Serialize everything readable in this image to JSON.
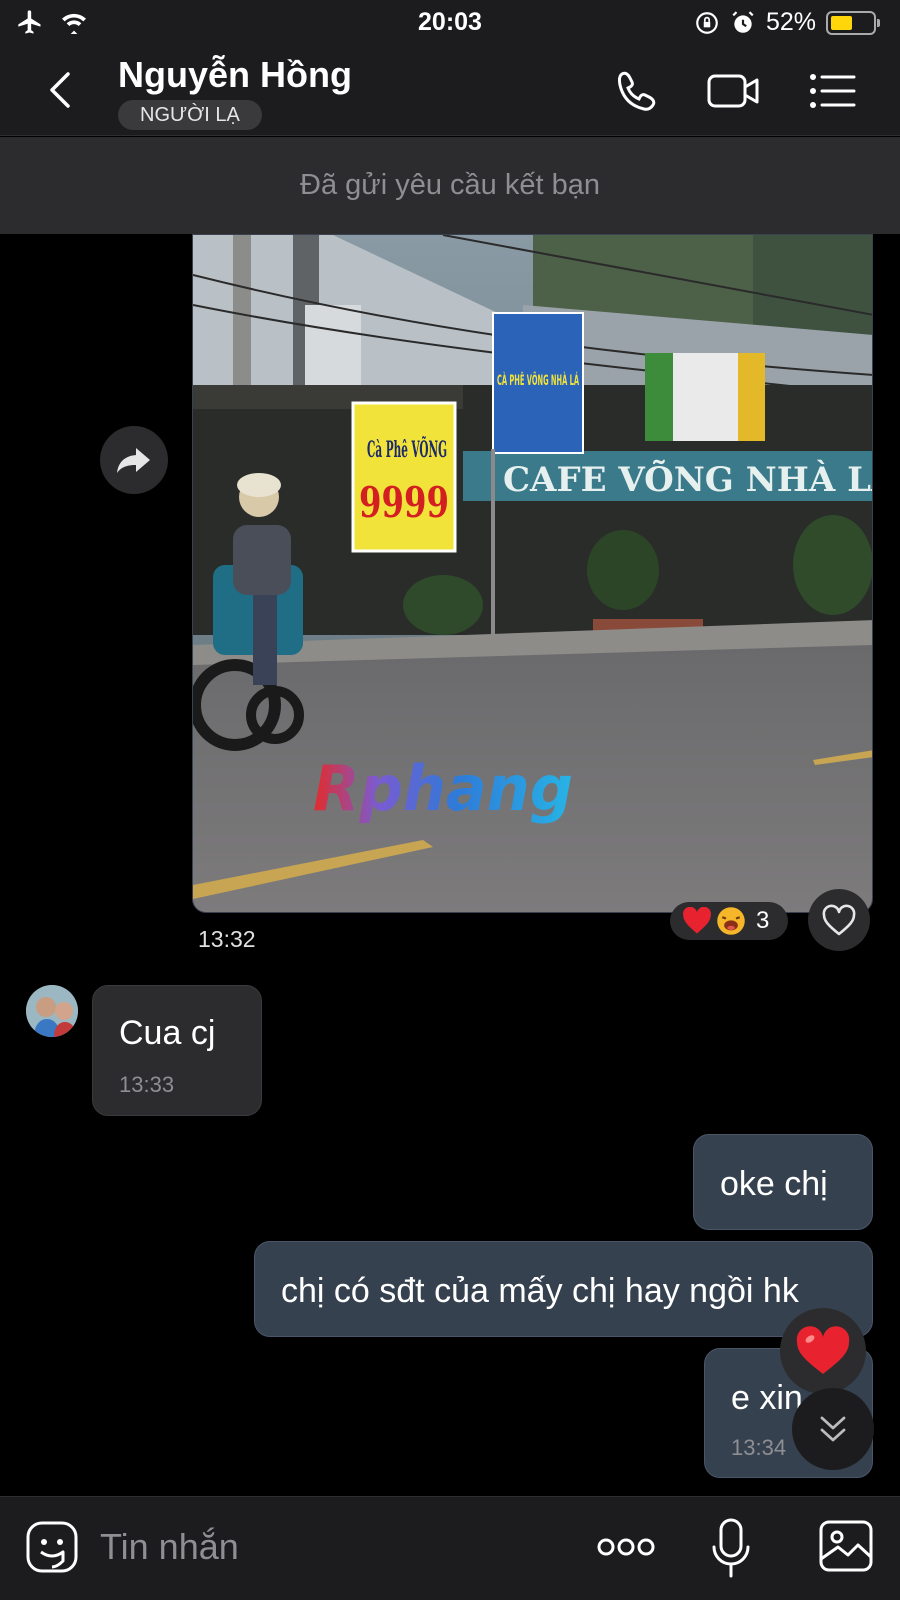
{
  "status_bar": {
    "time": "20:03",
    "battery_percent_label": "52%",
    "battery_level": 0.52,
    "icons": [
      "airplane-icon",
      "wifi-icon",
      "rotation-lock-icon",
      "alarm-icon",
      "battery-icon"
    ]
  },
  "header": {
    "contact_name": "Nguyễn Hồng",
    "badge": "NGƯỜI LẠ",
    "icons": [
      "back-icon",
      "phone-icon",
      "video-call-icon",
      "menu-icon"
    ]
  },
  "friend_request_banner": "Đã gửi yêu cầu kết bạn",
  "messages": {
    "photo": {
      "time": "13:32",
      "watermark": "Rphang",
      "sign_texts": [
        "Cà Phê VÕNG",
        "9999",
        "CÀ PHÊ VÕNG NHÀ LÁ",
        "CAFE VÕNG NHÀ LÁ"
      ],
      "reaction_count": "3",
      "reactions": [
        "heart",
        "laughing"
      ]
    },
    "incoming": {
      "text": "Cua cj",
      "time": "13:33"
    },
    "outgoing": [
      {
        "text": "oke chị"
      },
      {
        "text": "chị có sđt của mấy chị hay ngồi hk"
      },
      {
        "text": "e xin",
        "time": "13:34"
      }
    ]
  },
  "input_bar": {
    "placeholder": "Tin nhắn",
    "icons": [
      "sticker-icon",
      "more-icon",
      "microphone-icon",
      "gallery-icon"
    ]
  },
  "colors": {
    "background": "#000000",
    "bar": "#1c1c1e",
    "incoming_bubble": "#2c2c2e",
    "outgoing_bubble": "#36414f",
    "heart": "#e8232f",
    "battery": "#ffd60a"
  }
}
